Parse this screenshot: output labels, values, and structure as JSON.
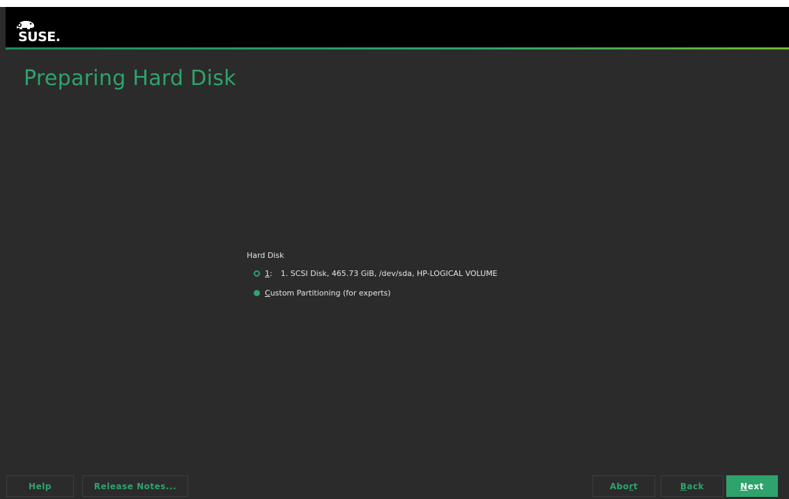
{
  "header": {
    "logo_text": "SUSE."
  },
  "page": {
    "title": "Preparing Hard Disk"
  },
  "hard_disk": {
    "label": "Hard Disk",
    "options": [
      {
        "mnemonic": "1",
        "key_suffix": ":",
        "label": "1. SCSI Disk, 465.73 GiB, /dev/sda, HP-LOGICAL VOLUME",
        "selected": false
      },
      {
        "mnemonic": "C",
        "label_rest": "ustom Partitioning (for experts)",
        "selected": true
      }
    ]
  },
  "footer": {
    "help": "Help",
    "release_notes": "Release Notes...",
    "abort_pre": "Abo",
    "abort_mnemonic": "r",
    "abort_post": "t",
    "back_mnemonic": "B",
    "back_rest": "ack",
    "next_mnemonic": "N",
    "next_rest": "ext"
  },
  "colors": {
    "accent": "#2fa36c",
    "background": "#2b2b2b",
    "header": "#000000",
    "text": "#e6e6e6"
  }
}
